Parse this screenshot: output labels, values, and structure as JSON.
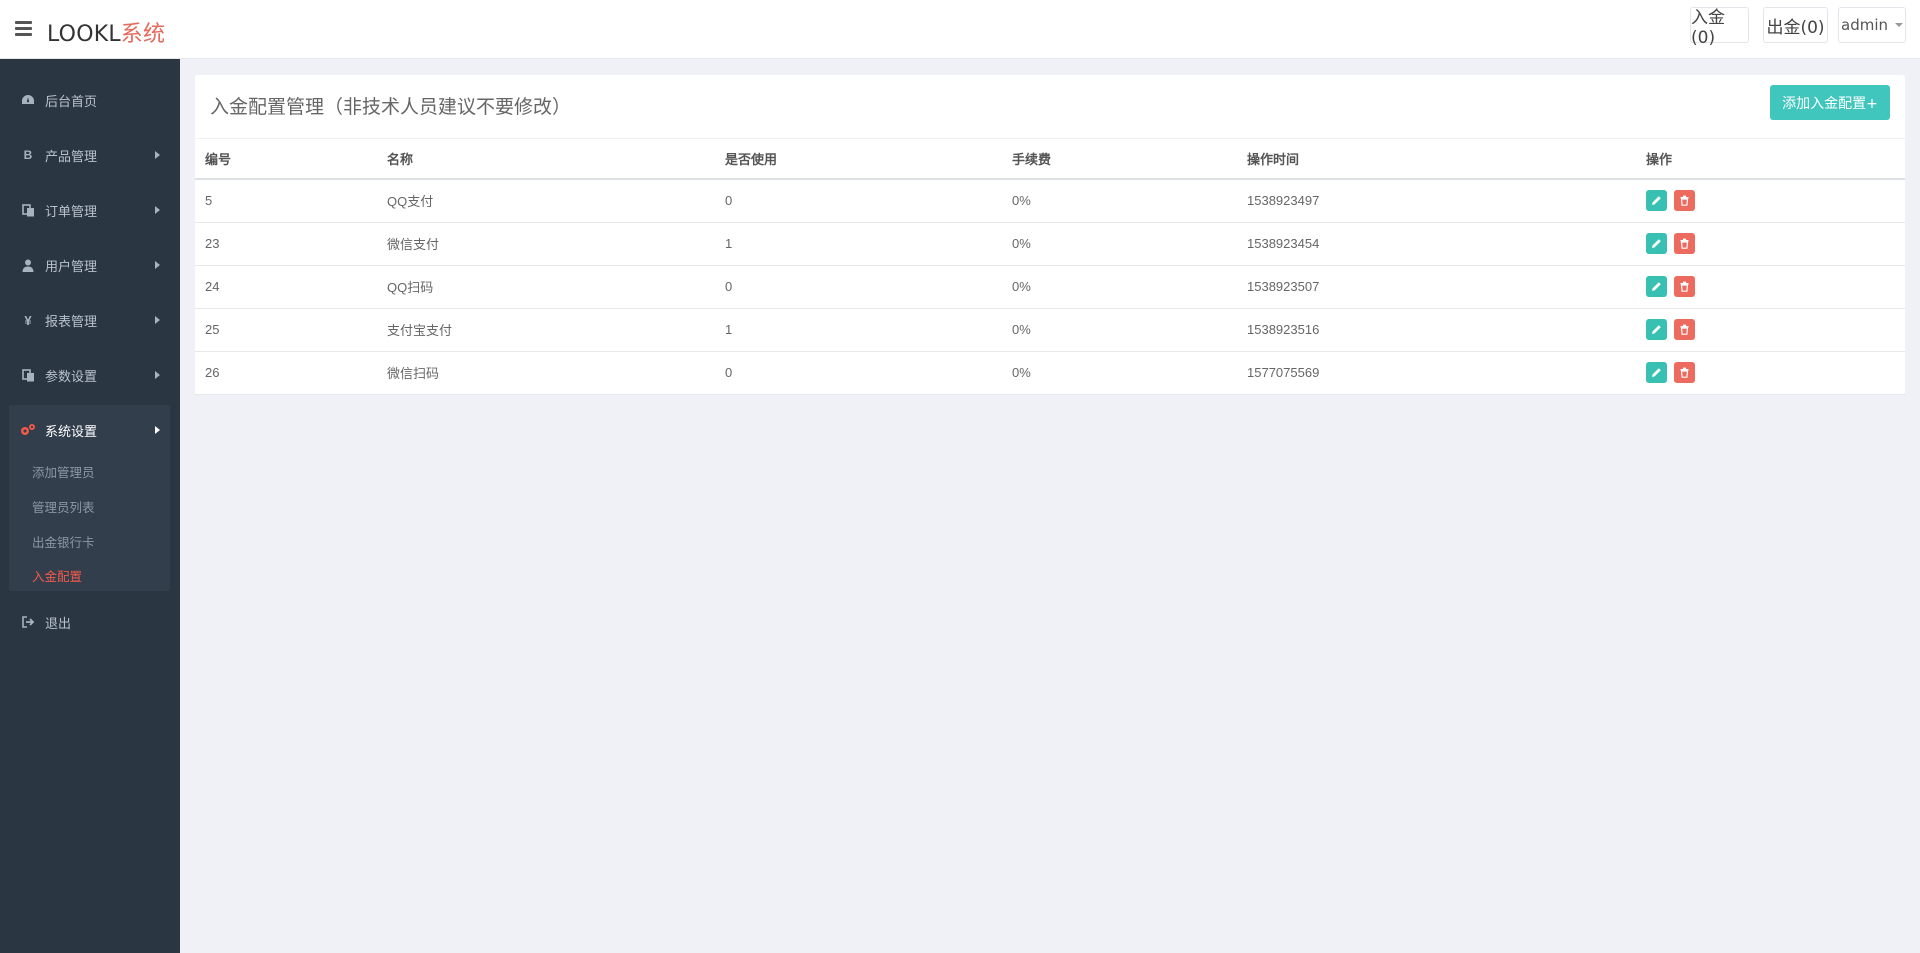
{
  "header": {
    "brand_main": "LOOKL",
    "brand_accent": "系统",
    "deposit_label": "入金(0)",
    "withdraw_label": "出金(0)",
    "user_label": "admin"
  },
  "sidebar": {
    "items": [
      {
        "label": "后台首页",
        "icon": "dashboard-icon"
      },
      {
        "label": "产品管理",
        "icon": "bitcoin-icon"
      },
      {
        "label": "订单管理",
        "icon": "copy-icon"
      },
      {
        "label": "用户管理",
        "icon": "user-icon"
      },
      {
        "label": "报表管理",
        "icon": "yen-icon"
      },
      {
        "label": "参数设置",
        "icon": "copy-icon"
      },
      {
        "label": "系统设置",
        "icon": "gears-icon"
      },
      {
        "label": "退出",
        "icon": "sign-out-icon"
      }
    ],
    "submenu": [
      {
        "label": "添加管理员"
      },
      {
        "label": "管理员列表"
      },
      {
        "label": "出金银行卡"
      },
      {
        "label": "入金配置"
      }
    ]
  },
  "main": {
    "title": "入金配置管理（非技术人员建议不要修改）",
    "add_button": "添加入金配置+",
    "columns": [
      "编号",
      "名称",
      "是否使用",
      "手续费",
      "操作时间",
      "操作"
    ],
    "rows": [
      {
        "id": "5",
        "name": "QQ支付",
        "enabled": "0",
        "fee": "0%",
        "time": "1538923497"
      },
      {
        "id": "23",
        "name": "微信支付",
        "enabled": "1",
        "fee": "0%",
        "time": "1538923454"
      },
      {
        "id": "24",
        "name": "QQ扫码",
        "enabled": "0",
        "fee": "0%",
        "time": "1538923507"
      },
      {
        "id": "25",
        "name": "支付宝支付",
        "enabled": "1",
        "fee": "0%",
        "time": "1538923516"
      },
      {
        "id": "26",
        "name": "微信扫码",
        "enabled": "0",
        "fee": "0%",
        "time": "1577075569"
      }
    ]
  },
  "colors": {
    "sidebar_bg": "#2b3643",
    "accent_teal": "#41c6bd",
    "accent_red": "#ec6b5e",
    "brand_accent": "#e36a5a"
  }
}
